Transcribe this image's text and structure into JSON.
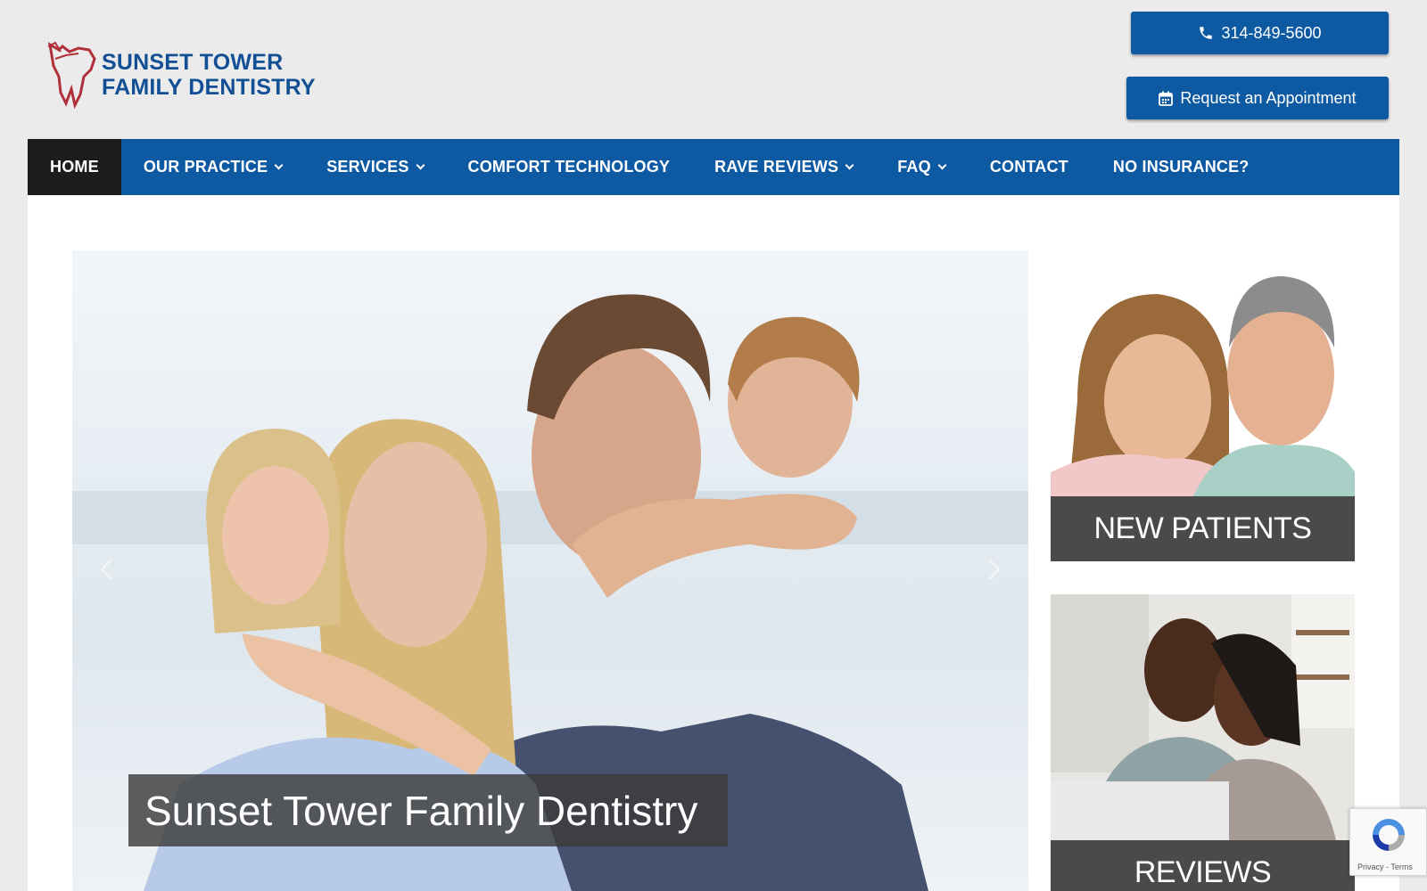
{
  "header": {
    "logo_line1": "SUNSET TOWER",
    "logo_line2": "FAMILY DENTISTRY",
    "phone_label": "314-849-5600",
    "appointment_label": "Request an Appointment",
    "phone_icon": "phone-icon",
    "calendar_icon": "calendar-icon"
  },
  "nav": {
    "items": [
      {
        "label": "HOME",
        "dropdown": false
      },
      {
        "label": "OUR PRACTICE",
        "dropdown": true
      },
      {
        "label": "SERVICES",
        "dropdown": true
      },
      {
        "label": "COMFORT TECHNOLOGY",
        "dropdown": false
      },
      {
        "label": "RAVE REVIEWS",
        "dropdown": true
      },
      {
        "label": "FAQ",
        "dropdown": true
      },
      {
        "label": "CONTACT",
        "dropdown": false
      },
      {
        "label": "NO INSURANCE?",
        "dropdown": false
      }
    ]
  },
  "hero": {
    "caption": "Sunset Tower Family Dentistry"
  },
  "sidebar": {
    "new_patients_label": "NEW PATIENTS",
    "reviews_label": "REVIEWS"
  },
  "recaptcha": {
    "links": "Privacy - Terms"
  },
  "colors": {
    "brand_blue": "#0d5aa3",
    "nav_active": "#1c1c1c",
    "card_label_bg": "#4a4a4a",
    "logo_red": "#b0303a"
  }
}
